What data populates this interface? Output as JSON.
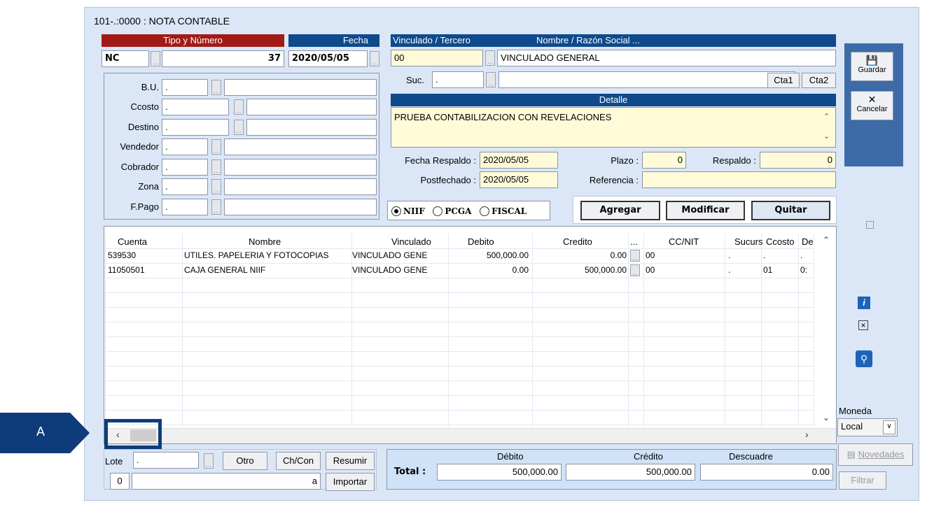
{
  "window": {
    "title": "101-.:0000 : NOTA CONTABLE"
  },
  "tipo": {
    "header": "Tipo y Número",
    "code": "NC",
    "number": "37"
  },
  "fecha": {
    "header": "Fecha",
    "value": "2020/05/05"
  },
  "tercero": {
    "vinculado_header": "Vinculado / Tercero",
    "nombre_header": "Nombre / Razón Social ...",
    "code": "00",
    "name": "VINCULADO GENERAL",
    "suc_label": "Suc.",
    "suc_value": ".",
    "cta1": "Cta1",
    "cta2": "Cta2"
  },
  "detalle": {
    "header": "Detalle",
    "text": "PRUEBA CONTABILIZACION CON REVELACIONES"
  },
  "left_fields": [
    {
      "label": "B.U.",
      "value": "."
    },
    {
      "label": "Ccosto",
      "value": "."
    },
    {
      "label": "Destino",
      "value": "."
    },
    {
      "label": "Vendedor",
      "value": "."
    },
    {
      "label": "Cobrador",
      "value": "."
    },
    {
      "label": "Zona",
      "value": "."
    },
    {
      "label": "F.Pago",
      "value": "."
    }
  ],
  "respaldo": {
    "fecha_label": "Fecha Respaldo :",
    "fecha_value": "2020/05/05",
    "post_label": "Postfechado :",
    "post_value": "2020/05/05",
    "plazo_label": "Plazo :",
    "plazo_value": "0",
    "respaldo_label": "Respaldo :",
    "respaldo_value": "0",
    "referencia_label": "Referencia :",
    "referencia_value": ""
  },
  "radios": {
    "niif": "NIIF",
    "pcga": "PCGA",
    "fiscal": "FISCAL",
    "selected": "NIIF"
  },
  "actions": {
    "agregar": "Agregar",
    "modificar": "Modificar",
    "quitar": "Quitar"
  },
  "side": {
    "guardar": "Guardar",
    "cancelar": "Cancelar",
    "moneda_label": "Moneda",
    "moneda_value": "Local",
    "novedades": "Novedades",
    "filtrar": "Filtrar"
  },
  "grid": {
    "headers": [
      "Cuenta",
      "Nombre",
      "Vinculado",
      "Debito",
      "Credito",
      "...",
      "CC/NIT",
      "Sucurs",
      "Ccosto",
      "De"
    ],
    "rows": [
      {
        "cuenta": "539530",
        "nombre": "UTILES. PAPELERIA Y FOTOCOPIAS",
        "vinculado": "VINCULADO GENE",
        "debito": "500,000.00",
        "credito": "0.00",
        "ccnit": "00",
        "sucurs": ".",
        "ccosto": ".",
        "de": "."
      },
      {
        "cuenta": "11050501",
        "nombre": "CAJA GENERAL NIIF",
        "vinculado": "VINCULADO GENE",
        "debito": "0.00",
        "credito": "500,000.00",
        "ccnit": "00",
        "sucurs": ".",
        "ccosto": "01",
        "de": "0:"
      }
    ]
  },
  "bottom": {
    "lote_label": "Lote",
    "lote_value": ".",
    "otro": "Otro",
    "chcon": "Ch/Con",
    "resumir": "Resumir",
    "importar": "Importar",
    "num_value": "0",
    "a_label": "a"
  },
  "totals": {
    "label": "Total :",
    "debito_header": "Débito",
    "credito_header": "Crédito",
    "descuadre_header": "Descuadre",
    "debito": "500,000.00",
    "credito": "500,000.00",
    "descuadre": "0.00"
  },
  "callout": {
    "label": "A",
    "color": "#0e3c7a"
  }
}
